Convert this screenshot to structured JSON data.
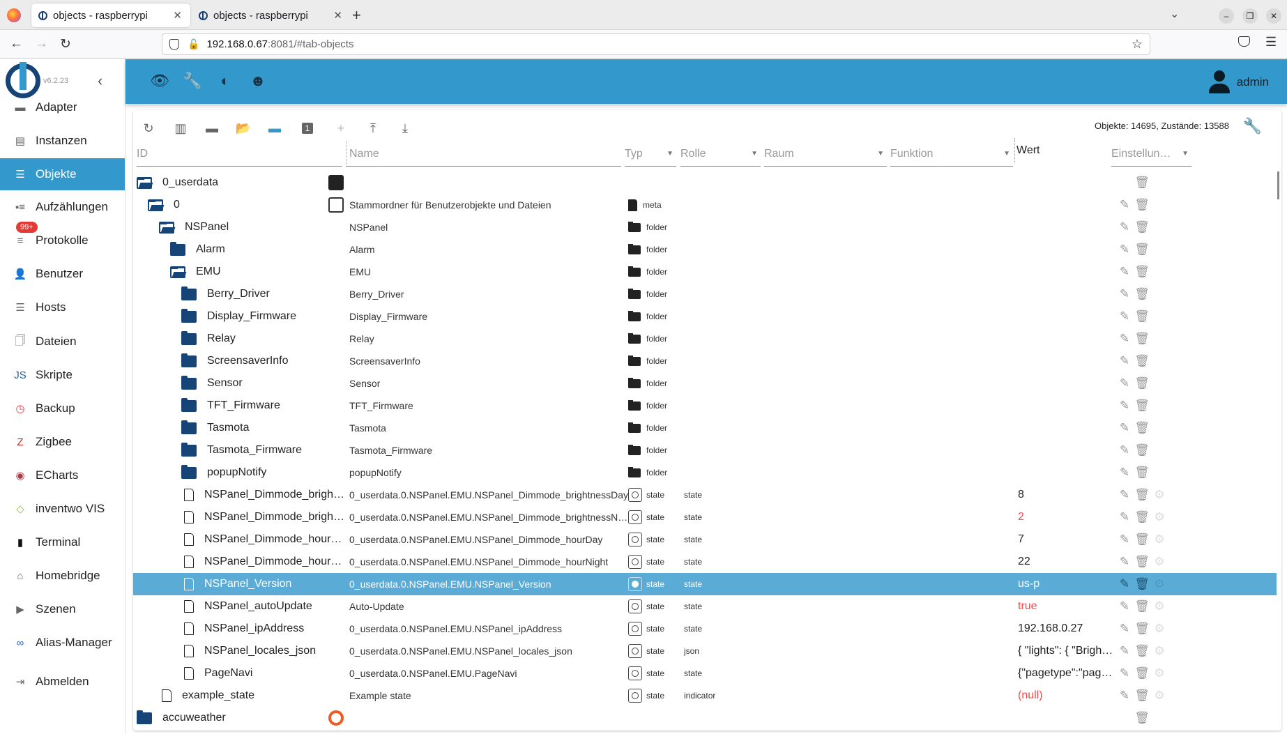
{
  "browser": {
    "tabs": [
      {
        "title": "objects - raspberrypi",
        "active": true
      },
      {
        "title": "objects - raspberrypi",
        "active": false
      }
    ],
    "url_host": "192.168.0.67",
    "url_rest": ":8081/#tab-objects"
  },
  "sidebar": {
    "version": "v6.2.23",
    "items": [
      {
        "label": "Adapter",
        "icon": "store-icon"
      },
      {
        "label": "Instanzen",
        "icon": "instances-icon"
      },
      {
        "label": "Objekte",
        "icon": "list-icon",
        "active": true
      },
      {
        "label": "Aufzählungen",
        "icon": "enums-icon"
      },
      {
        "label": "Protokolle",
        "icon": "logs-icon",
        "badge": "99+"
      },
      {
        "label": "Benutzer",
        "icon": "user-icon"
      },
      {
        "label": "Hosts",
        "icon": "hosts-icon"
      },
      {
        "label": "Dateien",
        "icon": "files-icon"
      },
      {
        "label": "Skripte",
        "icon": "js-icon"
      },
      {
        "label": "Backup",
        "icon": "backup-icon"
      },
      {
        "label": "Zigbee",
        "icon": "zigbee-icon"
      },
      {
        "label": "ECharts",
        "icon": "echarts-icon"
      },
      {
        "label": "inventwo VIS",
        "icon": "inventwo-icon"
      },
      {
        "label": "Terminal",
        "icon": "terminal-icon"
      },
      {
        "label": "Homebridge",
        "icon": "homebridge-icon"
      },
      {
        "label": "Szenen",
        "icon": "scenes-icon"
      },
      {
        "label": "Alias-Manager",
        "icon": "alias-icon"
      },
      {
        "label": "Abmelden",
        "icon": "logout-icon"
      }
    ]
  },
  "appbar": {
    "user": "admin"
  },
  "objects": {
    "stats": "Objekte: 14695, Zustände: 13588",
    "headers": {
      "id": "ID",
      "name": "Name",
      "typ": "Typ",
      "rolle": "Rolle",
      "raum": "Raum",
      "funktion": "Funktion",
      "wert": "Wert",
      "einstellungen": "Einstellun…"
    },
    "rows": [
      {
        "id": "0_userdata",
        "level": 0,
        "kind": "folder-open",
        "name": "",
        "typ": "",
        "role": "",
        "value": "",
        "extra": "image"
      },
      {
        "id": "0",
        "level": 1,
        "kind": "folder-open",
        "name": "Stammordner für Benutzerobjekte und Dateien",
        "typ": "meta",
        "role": "",
        "value": "",
        "extra": "doc"
      },
      {
        "id": "NSPanel",
        "level": 2,
        "kind": "folder-open",
        "name": "NSPanel",
        "typ": "folder",
        "role": "",
        "value": ""
      },
      {
        "id": "Alarm",
        "level": 3,
        "kind": "folder",
        "name": "Alarm",
        "typ": "folder",
        "role": "",
        "value": ""
      },
      {
        "id": "EMU",
        "level": 3,
        "kind": "folder-open",
        "name": "EMU",
        "typ": "folder",
        "role": "",
        "value": ""
      },
      {
        "id": "Berry_Driver",
        "level": 4,
        "kind": "folder",
        "name": "Berry_Driver",
        "typ": "folder",
        "role": "",
        "value": ""
      },
      {
        "id": "Display_Firmware",
        "level": 4,
        "kind": "folder",
        "name": "Display_Firmware",
        "typ": "folder",
        "role": "",
        "value": ""
      },
      {
        "id": "Relay",
        "level": 4,
        "kind": "folder",
        "name": "Relay",
        "typ": "folder",
        "role": "",
        "value": ""
      },
      {
        "id": "ScreensaverInfo",
        "level": 4,
        "kind": "folder",
        "name": "ScreensaverInfo",
        "typ": "folder",
        "role": "",
        "value": ""
      },
      {
        "id": "Sensor",
        "level": 4,
        "kind": "folder",
        "name": "Sensor",
        "typ": "folder",
        "role": "",
        "value": ""
      },
      {
        "id": "TFT_Firmware",
        "level": 4,
        "kind": "folder",
        "name": "TFT_Firmware",
        "typ": "folder",
        "role": "",
        "value": ""
      },
      {
        "id": "Tasmota",
        "level": 4,
        "kind": "folder",
        "name": "Tasmota",
        "typ": "folder",
        "role": "",
        "value": ""
      },
      {
        "id": "Tasmota_Firmware",
        "level": 4,
        "kind": "folder",
        "name": "Tasmota_Firmware",
        "typ": "folder",
        "role": "",
        "value": ""
      },
      {
        "id": "popupNotify",
        "level": 4,
        "kind": "folder",
        "name": "popupNotify",
        "typ": "folder",
        "role": "",
        "value": ""
      },
      {
        "id": "NSPanel_Dimmode_brigh…",
        "level": 4,
        "kind": "state",
        "name": "0_userdata.0.NSPanel.EMU.NSPanel_Dimmode_brightnessDay",
        "typ": "state",
        "role": "state",
        "value": "8"
      },
      {
        "id": "NSPanel_Dimmode_brigh…",
        "level": 4,
        "kind": "state",
        "name": "0_userdata.0.NSPanel.EMU.NSPanel_Dimmode_brightnessN…",
        "typ": "state",
        "role": "state",
        "value": "2",
        "red": true
      },
      {
        "id": "NSPanel_Dimmode_hour…",
        "level": 4,
        "kind": "state",
        "name": "0_userdata.0.NSPanel.EMU.NSPanel_Dimmode_hourDay",
        "typ": "state",
        "role": "state",
        "value": "7"
      },
      {
        "id": "NSPanel_Dimmode_hour…",
        "level": 4,
        "kind": "state",
        "name": "0_userdata.0.NSPanel.EMU.NSPanel_Dimmode_hourNight",
        "typ": "state",
        "role": "state",
        "value": "22"
      },
      {
        "id": "NSPanel_Version",
        "level": 4,
        "kind": "state",
        "name": "0_userdata.0.NSPanel.EMU.NSPanel_Version",
        "typ": "state",
        "role": "state",
        "value": "us-p",
        "selected": true
      },
      {
        "id": "NSPanel_autoUpdate",
        "level": 4,
        "kind": "state",
        "name": "Auto-Update",
        "typ": "state",
        "role": "state",
        "value": "true",
        "red": true
      },
      {
        "id": "NSPanel_ipAddress",
        "level": 4,
        "kind": "state",
        "name": "0_userdata.0.NSPanel.EMU.NSPanel_ipAddress",
        "typ": "state",
        "role": "state",
        "value": "192.168.0.27"
      },
      {
        "id": "NSPanel_locales_json",
        "level": 4,
        "kind": "state",
        "name": "0_userdata.0.NSPanel.EMU.NSPanel_locales_json",
        "typ": "state",
        "role": "json",
        "value": "{ \"lights\": { \"Brigh…"
      },
      {
        "id": "PageNavi",
        "level": 4,
        "kind": "state",
        "name": "0_userdata.0.NSPanel.EMU.PageNavi",
        "typ": "state",
        "role": "state",
        "value": "{\"pagetype\":\"pag…"
      },
      {
        "id": "example_state",
        "level": 2,
        "kind": "state",
        "name": "Example state",
        "typ": "state",
        "role": "indicator",
        "value": "(null)",
        "red": true
      },
      {
        "id": "accuweather",
        "level": 0,
        "kind": "folder",
        "name": "",
        "typ": "",
        "role": "",
        "value": "",
        "extra": "accuweather"
      }
    ]
  }
}
